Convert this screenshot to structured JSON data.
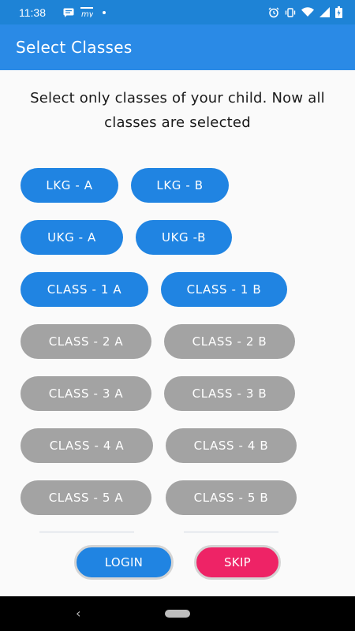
{
  "status_bar": {
    "time": "11:38",
    "icons_left": [
      "message-icon",
      "app-notification-icon",
      "dot-icon"
    ],
    "icons_right": [
      "alarm-icon",
      "vibrate-icon",
      "wifi-icon",
      "signal-icon",
      "battery-icon"
    ]
  },
  "app_bar": {
    "title": "Select Classes",
    "color": "#2a8ae6"
  },
  "instruction": "Select only classes of your child. Now all classes are selected",
  "classes": [
    {
      "label": "LKG - A",
      "selected": true
    },
    {
      "label": "LKG - B",
      "selected": true
    },
    {
      "label": "UKG - A",
      "selected": true
    },
    {
      "label": "UKG -B",
      "selected": true
    },
    {
      "label": "CLASS - 1 A",
      "selected": true
    },
    {
      "label": "CLASS - 1 B",
      "selected": true
    },
    {
      "label": "CLASS - 2 A",
      "selected": false
    },
    {
      "label": "CLASS - 2 B",
      "selected": false
    },
    {
      "label": "CLASS - 3 A",
      "selected": false
    },
    {
      "label": "CLASS - 3 B",
      "selected": false
    },
    {
      "label": "CLASS - 4 A",
      "selected": false
    },
    {
      "label": "CLASS - 4 B",
      "selected": false
    },
    {
      "label": "CLASS - 5 A",
      "selected": false
    },
    {
      "label": "CLASS - 5 B",
      "selected": false
    }
  ],
  "buttons": {
    "login_label": "LOGIN",
    "skip_label": "SKIP"
  },
  "colors": {
    "selected": "#2084e2",
    "unselected": "#a3a3a3",
    "skip": "#ee2366"
  },
  "nav_bar": {
    "icons": [
      "back-icon",
      "home-pill-icon"
    ]
  }
}
